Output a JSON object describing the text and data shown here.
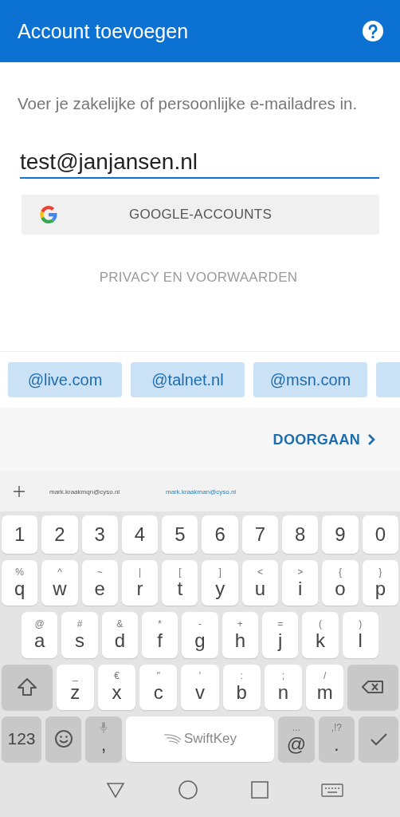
{
  "app_bar": {
    "title": "Account toevoegen"
  },
  "instruction": "Voer je zakelijke of persoonlijke e-mailadres in.",
  "email_field": {
    "value": "test@janjansen.nl"
  },
  "google_button": {
    "label": "GOOGLE-ACCOUNTS"
  },
  "privacy_link": {
    "label": "PRIVACY EN VOORWAARDEN"
  },
  "domain_chips": [
    {
      "label": "@live.com"
    },
    {
      "label": "@talnet.nl"
    },
    {
      "label": "@msn.com"
    }
  ],
  "continue_button": {
    "label": "DOORGAAN"
  },
  "suggestions": [
    {
      "label": "mark.kraakmqn@cyso.nl",
      "selected": false
    },
    {
      "label": "mark.kraakman@cyso.nl",
      "selected": true
    }
  ],
  "keyboard": {
    "number_row": [
      {
        "kind": "char",
        "label": "1"
      },
      {
        "kind": "char",
        "label": "2"
      },
      {
        "kind": "char",
        "label": "3"
      },
      {
        "kind": "char",
        "label": "4"
      },
      {
        "kind": "char",
        "label": "5"
      },
      {
        "kind": "char",
        "label": "6"
      },
      {
        "kind": "char",
        "label": "7"
      },
      {
        "kind": "char",
        "label": "8"
      },
      {
        "kind": "char",
        "label": "9"
      },
      {
        "kind": "char",
        "label": "0"
      }
    ],
    "top_row": [
      {
        "kind": "char",
        "label": "q",
        "hint": "%"
      },
      {
        "kind": "char",
        "label": "w",
        "hint": "^"
      },
      {
        "kind": "char",
        "label": "e",
        "hint": "~"
      },
      {
        "kind": "char",
        "label": "r",
        "hint": "|"
      },
      {
        "kind": "char",
        "label": "t",
        "hint": "["
      },
      {
        "kind": "char",
        "label": "y",
        "hint": "]"
      },
      {
        "kind": "char",
        "label": "u",
        "hint": "<"
      },
      {
        "kind": "char",
        "label": "i",
        "hint": ">"
      },
      {
        "kind": "char",
        "label": "o",
        "hint": "{"
      },
      {
        "kind": "char",
        "label": "p",
        "hint": "}"
      }
    ],
    "home_row": [
      {
        "kind": "char",
        "label": "a",
        "hint": "@"
      },
      {
        "kind": "char",
        "label": "s",
        "hint": "#"
      },
      {
        "kind": "char",
        "label": "d",
        "hint": "&"
      },
      {
        "kind": "char",
        "label": "f",
        "hint": "*"
      },
      {
        "kind": "char",
        "label": "g",
        "hint": "-"
      },
      {
        "kind": "char",
        "label": "h",
        "hint": "+"
      },
      {
        "kind": "char",
        "label": "j",
        "hint": "="
      },
      {
        "kind": "char",
        "label": "k",
        "hint": "("
      },
      {
        "kind": "char",
        "label": "l",
        "hint": ")"
      }
    ],
    "bottom_row": [
      {
        "kind": "shift"
      },
      {
        "kind": "char",
        "label": "z",
        "hint": "_"
      },
      {
        "kind": "char",
        "label": "x",
        "hint": "€"
      },
      {
        "kind": "char",
        "label": "c",
        "hint": "\""
      },
      {
        "kind": "char",
        "label": "v",
        "hint": "'"
      },
      {
        "kind": "char",
        "label": "b",
        "hint": ":"
      },
      {
        "kind": "char",
        "label": "n",
        "hint": ";"
      },
      {
        "kind": "char",
        "label": "m",
        "hint": "/"
      },
      {
        "kind": "backspace"
      }
    ],
    "function_row": [
      {
        "kind": "symbols",
        "label": "123"
      },
      {
        "kind": "emoji"
      },
      {
        "kind": "mic-punct",
        "label": ","
      },
      {
        "kind": "space",
        "label": "SwiftKey"
      },
      {
        "kind": "punct",
        "label": "@",
        "hint": "..."
      },
      {
        "kind": "punct",
        "label": ".",
        "hint": ",!?"
      },
      {
        "kind": "enter"
      }
    ]
  }
}
